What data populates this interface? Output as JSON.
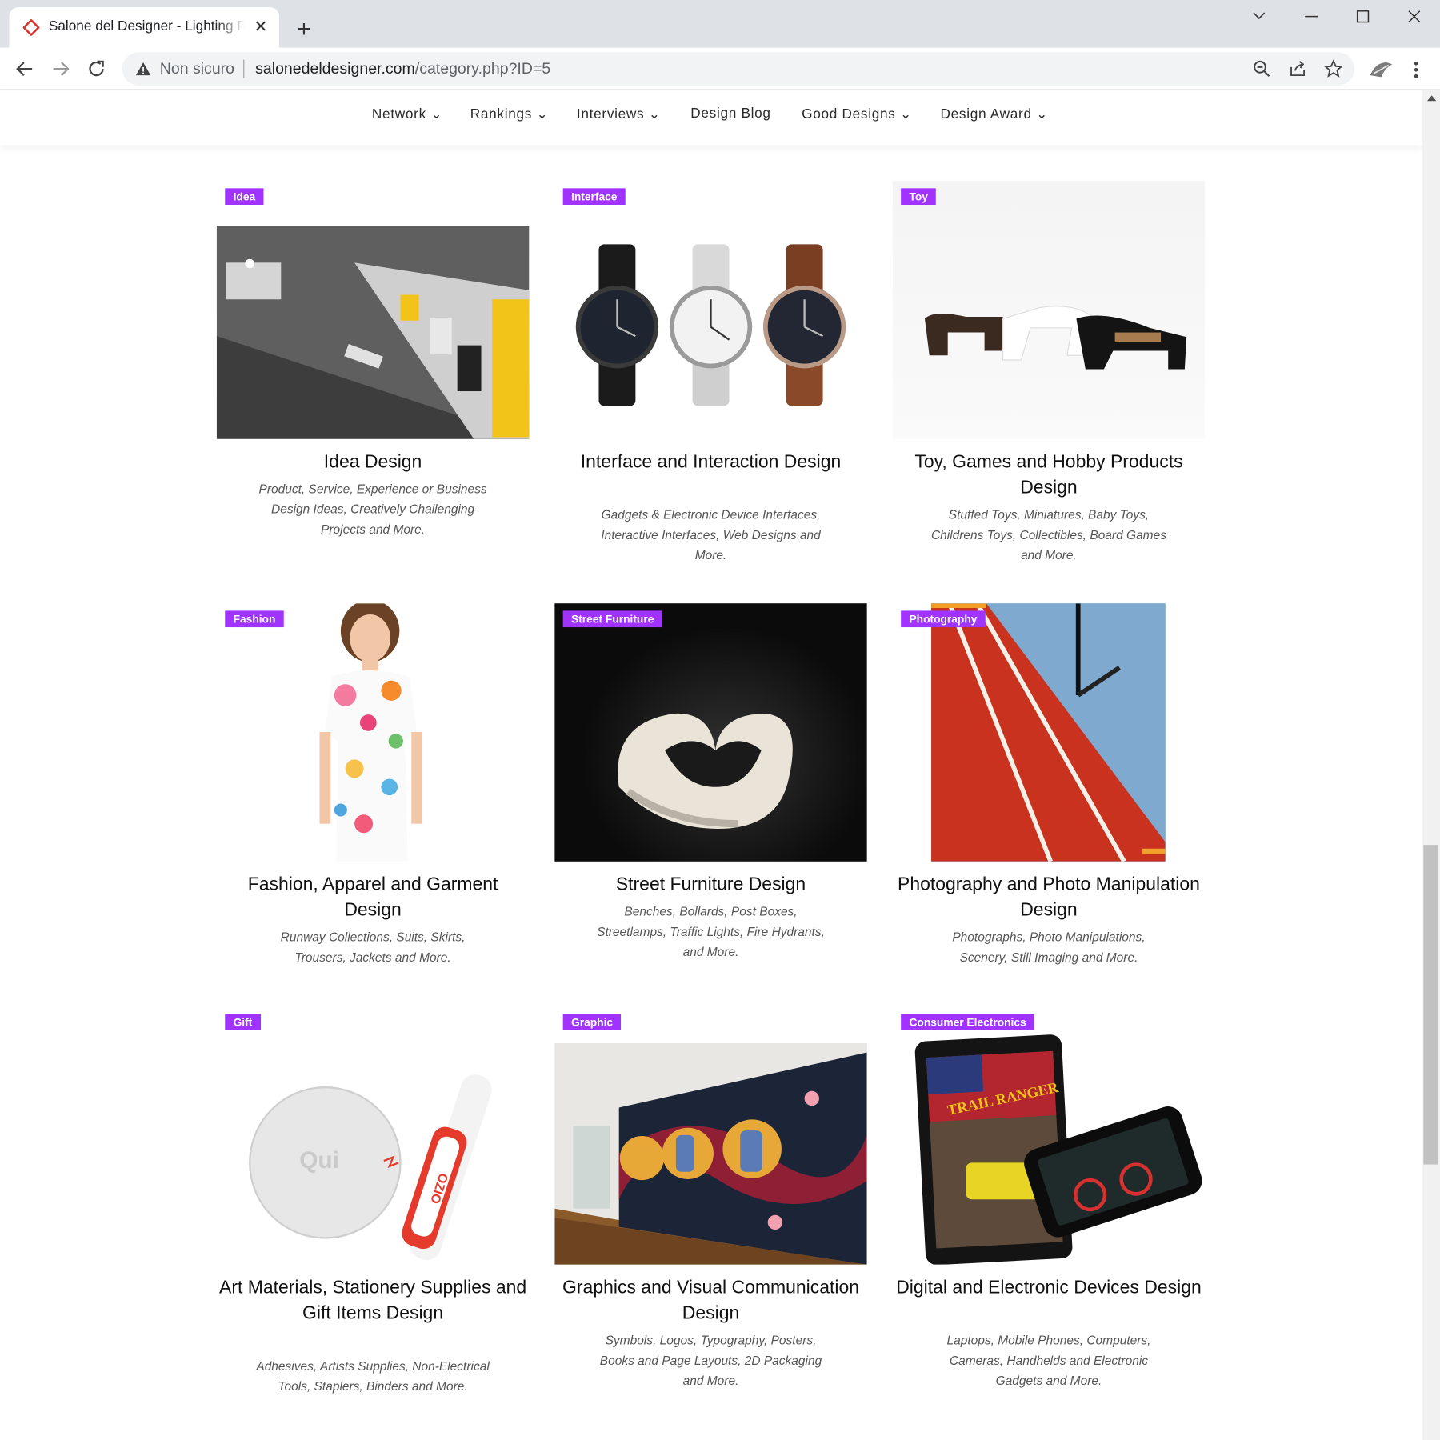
{
  "browser": {
    "tab_title": "Salone del Designer - Lighting Products",
    "new_tab_label": "+",
    "security_label": "Non sicuro",
    "url_domain": "salonedeldesigner.com",
    "url_path": "/category.php?ID=5",
    "icons": [
      "favicon-icon",
      "close-icon",
      "back-icon",
      "forward-icon",
      "reload-icon",
      "warning-icon",
      "zoom-icon",
      "share-icon",
      "star-icon",
      "extension-icon",
      "menu-icon"
    ]
  },
  "nav": {
    "items": [
      {
        "label": "Network ⌄"
      },
      {
        "label": "Rankings ⌄"
      },
      {
        "label": "Interviews ⌄"
      },
      {
        "label": "Design Blog"
      },
      {
        "label": "Good Designs ⌄"
      },
      {
        "label": "Design Award ⌄"
      }
    ]
  },
  "colors": {
    "badge": "#a033ff"
  },
  "cards": [
    {
      "badge": "Idea",
      "title": "Idea Design",
      "desc": "Product, Service, Experience or Business Design Ideas, Creatively Challenging Projects and More."
    },
    {
      "badge": "Interface",
      "title": "Interface and Interaction Design",
      "desc": "Gadgets & Electronic Device Interfaces, Interactive Interfaces, Web Designs and More."
    },
    {
      "badge": "Toy",
      "title": "Toy, Games and Hobby Products Design",
      "desc": "Stuffed Toys, Miniatures, Baby Toys, Childrens Toys, Collectibles, Board Games and More."
    },
    {
      "badge": "Fashion",
      "title": "Fashion, Apparel and Garment Design",
      "desc": "Runway Collections, Suits, Skirts, Trousers, Jackets and More."
    },
    {
      "badge": "Street Furniture",
      "title": "Street Furniture Design",
      "desc": "Benches, Bollards, Post Boxes, Streetlamps, Traffic Lights, Fire Hydrants, and More."
    },
    {
      "badge": "Photography",
      "title": "Photography and Photo Manipulation Design",
      "desc": "Photographs, Photo Manipulations, Scenery, Still Imaging and More."
    },
    {
      "badge": "Gift",
      "title": "Art Materials, Stationery Supplies and Gift Items Design",
      "desc": "Adhesives, Artists Supplies, Non-Electrical Tools, Staplers, Binders and More."
    },
    {
      "badge": "Graphic",
      "title": "Graphics and Visual Communication Design",
      "desc": "Symbols, Logos, Typography, Posters, Books and Page Layouts, 2D Packaging and More."
    },
    {
      "badge": "Consumer Electronics",
      "title": "Digital and Electronic Devices Design",
      "desc": "Laptops, Mobile Phones, Computers, Cameras, Handhelds and Electronic Gadgets and More."
    }
  ],
  "image_texts": {
    "gift_product": "Qui",
    "gift_stick": "OZIO",
    "tablet_game": "TRAIL RANGER"
  }
}
